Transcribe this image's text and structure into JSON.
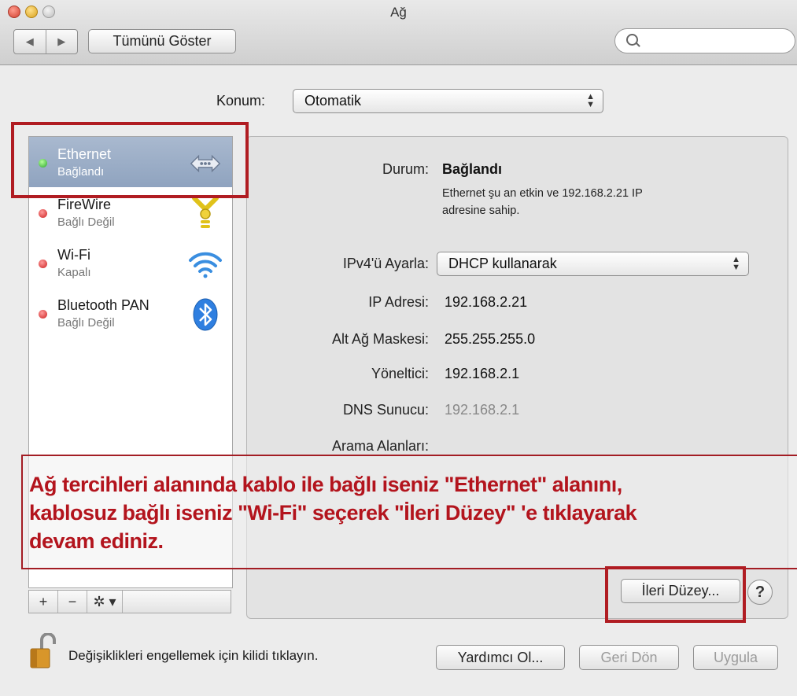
{
  "window": {
    "title": "Ağ"
  },
  "toolbar": {
    "back_glyph": "◀",
    "forward_glyph": "▶",
    "show_all_label": "Tümünü Göster",
    "search_placeholder": ""
  },
  "location": {
    "label": "Konum:",
    "value": "Otomatik"
  },
  "services": [
    {
      "name": "Ethernet",
      "status": "Bağlandı",
      "status_color": "green",
      "icon": "ethernet-icon",
      "selected": true
    },
    {
      "name": "FireWire",
      "status": "Bağlı Değil",
      "status_color": "red",
      "icon": "firewire-icon",
      "selected": false
    },
    {
      "name": "Wi-Fi",
      "status": "Kapalı",
      "status_color": "red",
      "icon": "wifi-icon",
      "selected": false
    },
    {
      "name": "Bluetooth PAN",
      "status": "Bağlı Değil",
      "status_color": "red",
      "icon": "bluetooth-icon",
      "selected": false
    }
  ],
  "sidebar_controls": {
    "add": "+",
    "remove": "−",
    "gear": "✲ ▾"
  },
  "detail": {
    "status_label": "Durum:",
    "status_value": "Bağlandı",
    "status_desc_line1": "Ethernet şu an etkin ve 192.168.2.21 IP",
    "status_desc_line2": "adresine sahip.",
    "ipv4_label": "IPv4'ü Ayarla:",
    "ipv4_value": "DHCP kullanarak",
    "ip_label": "IP Adresi:",
    "ip_value": "192.168.2.21",
    "mask_label": "Alt Ağ Maskesi:",
    "mask_value": "255.255.255.0",
    "router_label": "Yöneltici:",
    "router_value": "192.168.2.1",
    "dns_label": "DNS Sunucu:",
    "dns_value": "192.168.2.1",
    "search_domains_label": "Arama Alanları:",
    "advanced_label": "İleri Düzey...",
    "help_label": "?"
  },
  "annotation": {
    "line1": "Ağ tercihleri alanında kablo ile bağlı iseniz \"Ethernet\" alanını,",
    "line2": "kablosuz bağlı iseniz \"Wi-Fi\" seçerek \"İleri Düzey\" 'e tıklayarak",
    "line3": "devam ediniz."
  },
  "footer": {
    "lock_text": "Değişiklikleri engellemek için kilidi tıklayın.",
    "assist_label": "Yardımcı Ol...",
    "revert_label": "Geri Dön",
    "apply_label": "Uygula"
  },
  "colors": {
    "highlight_red": "#b01c22",
    "annotation_text": "#b3141d",
    "selection": "#8fa3bf"
  }
}
